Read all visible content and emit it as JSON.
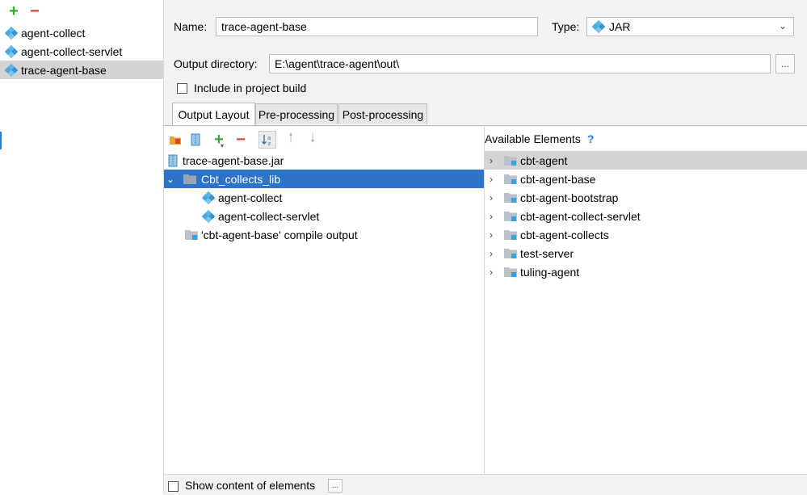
{
  "artifacts": {
    "toolbar": {
      "add_icon": "plus-icon",
      "remove_icon": "minus-icon"
    },
    "items": [
      {
        "label": "agent-collect",
        "icon": "artifact-diamond-icon"
      },
      {
        "label": "agent-collect-servlet",
        "icon": "artifact-diamond-icon"
      },
      {
        "label": "trace-agent-base",
        "icon": "artifact-diamond-icon",
        "selected": true
      }
    ]
  },
  "form": {
    "name_label": "Name:",
    "name_value": "trace-agent-base",
    "type_label": "Type:",
    "type_value": "JAR",
    "output_dir_label": "Output directory:",
    "output_dir_value": "E:\\agent\\trace-agent\\out\\",
    "browse_label": "...",
    "include_label": "Include in project build",
    "include_checked": false
  },
  "tabs": [
    {
      "label": "Output Layout",
      "active": true
    },
    {
      "label": "Pre-processing",
      "active": false
    },
    {
      "label": "Post-processing",
      "active": false
    }
  ],
  "layout_toolbar": {
    "icons": [
      "new-directory-icon",
      "archive-icon",
      "add-icon",
      "remove-icon",
      "sort-icon",
      "move-up-icon",
      "move-down-icon"
    ]
  },
  "layout_tree": [
    {
      "label": "trace-agent-base.jar",
      "icon": "jar-icon",
      "level": 0
    },
    {
      "label": "Cbt_collects_lib",
      "icon": "folder-icon",
      "level": 0,
      "expanded": true,
      "selected": true
    },
    {
      "label": "agent-collect",
      "icon": "artifact-diamond-icon",
      "level": 2
    },
    {
      "label": "agent-collect-servlet",
      "icon": "artifact-diamond-icon",
      "level": 2
    },
    {
      "label": "'cbt-agent-base' compile output",
      "icon": "module-folder-icon",
      "level": 1
    }
  ],
  "available": {
    "title": "Available Elements",
    "help": "?",
    "items": [
      {
        "label": "cbt-agent",
        "selected": true
      },
      {
        "label": "cbt-agent-base"
      },
      {
        "label": "cbt-agent-bootstrap"
      },
      {
        "label": "cbt-agent-collect-servlet"
      },
      {
        "label": "cbt-agent-collects"
      },
      {
        "label": "test-server"
      },
      {
        "label": "tuling-agent"
      }
    ]
  },
  "bottom": {
    "show_content_label": "Show content of elements",
    "show_content_checked": false,
    "more_label": "..."
  },
  "colors": {
    "selection_blue": "#2c74c9",
    "selection_gray": "#d4d4d4",
    "add_green": "#3ba83b",
    "remove_red": "#d9413b",
    "artifact_blue": "#4aa8e0",
    "help_blue": "#2b7bd6"
  }
}
